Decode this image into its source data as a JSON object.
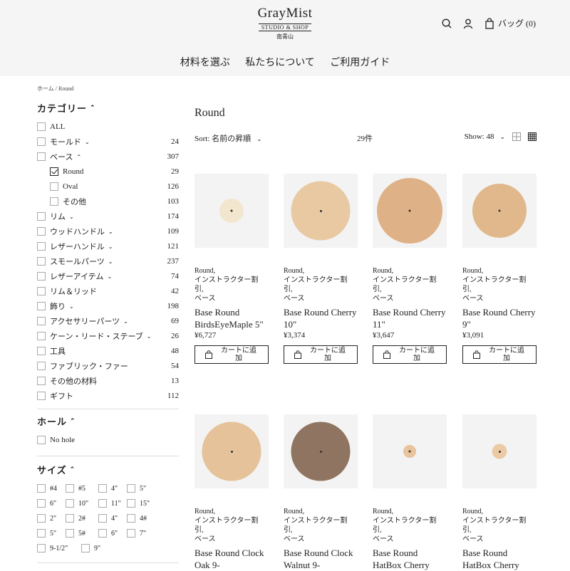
{
  "header": {
    "logo_main": "GrayMist",
    "logo_sub": "STUDIO & SHOP",
    "logo_sub2": "南青山",
    "bag_label": "バッグ (0)",
    "nav": [
      "材料を選ぶ",
      "私たちについて",
      "ご利用ガイド"
    ]
  },
  "breadcrumb": "ホーム / Round",
  "sidebar": {
    "category_title": "カテゴリー",
    "categories": [
      {
        "label": "ALL",
        "count": "",
        "chev": false,
        "checked": false,
        "indent": false
      },
      {
        "label": "モールド",
        "count": "24",
        "chev": "down",
        "checked": false,
        "indent": false
      },
      {
        "label": "ベース",
        "count": "307",
        "chev": "up",
        "checked": false,
        "indent": false
      },
      {
        "label": "Round",
        "count": "29",
        "chev": false,
        "checked": true,
        "indent": true
      },
      {
        "label": "Oval",
        "count": "126",
        "chev": false,
        "checked": false,
        "indent": true
      },
      {
        "label": "その他",
        "count": "103",
        "chev": false,
        "checked": false,
        "indent": true
      },
      {
        "label": "リム",
        "count": "174",
        "chev": "down",
        "checked": false,
        "indent": false
      },
      {
        "label": "ウッドハンドル",
        "count": "109",
        "chev": "down",
        "checked": false,
        "indent": false
      },
      {
        "label": "レザーハンドル",
        "count": "121",
        "chev": "down",
        "checked": false,
        "indent": false
      },
      {
        "label": "スモールパーツ",
        "count": "237",
        "chev": "down",
        "checked": false,
        "indent": false
      },
      {
        "label": "レザーアイテム",
        "count": "74",
        "chev": "down",
        "checked": false,
        "indent": false
      },
      {
        "label": "リム＆リッド",
        "count": "42",
        "chev": false,
        "checked": false,
        "indent": false
      },
      {
        "label": "飾り",
        "count": "198",
        "chev": "down",
        "checked": false,
        "indent": false
      },
      {
        "label": "アクセサリーパーツ",
        "count": "69",
        "chev": "down",
        "checked": false,
        "indent": false
      },
      {
        "label": "ケーン・リード・ステーブ",
        "count": "26",
        "chev": "down",
        "checked": false,
        "indent": false
      },
      {
        "label": "工具",
        "count": "48",
        "chev": false,
        "checked": false,
        "indent": false
      },
      {
        "label": "ファブリック・ファー",
        "count": "54",
        "chev": false,
        "checked": false,
        "indent": false
      },
      {
        "label": "その他の材料",
        "count": "13",
        "chev": false,
        "checked": false,
        "indent": false
      },
      {
        "label": "ギフト",
        "count": "112",
        "chev": false,
        "checked": false,
        "indent": false
      }
    ],
    "hole_title": "ホール",
    "hole_options": [
      "No hole"
    ],
    "size_title": "サイズ",
    "sizes": [
      [
        "#4",
        "#5",
        "4\"",
        "5\""
      ],
      [
        "6\"",
        "10\"",
        "11\"",
        "15\""
      ],
      [
        "2\"",
        "2#",
        "4\"",
        "4#"
      ],
      [
        "5\"",
        "5#",
        "6\"",
        "7\""
      ],
      [
        "9-1/2\"",
        "9\""
      ]
    ]
  },
  "main": {
    "title": "Round",
    "sort_label": "Sort: 名前の昇順",
    "count_label": "29件",
    "show_label": "Show: 48",
    "cart_label": "カートに追加",
    "products": [
      {
        "tags": [
          "Round,",
          "インストラクター割",
          "引,",
          "ベース"
        ],
        "name": "Base Round BirdsEyeMaple 5\"",
        "price": "¥6,727",
        "disc_size": 0.33,
        "disc_color": "#f2e6cf"
      },
      {
        "tags": [
          "Round,",
          "インストラクター割",
          "引,",
          "ベース"
        ],
        "name": "Base Round Cherry 10\"",
        "price": "¥3,374",
        "disc_size": 0.8,
        "disc_color": "#e8c9a2"
      },
      {
        "tags": [
          "Round,",
          "インストラクター割",
          "引,",
          "ベース"
        ],
        "name": "Base Round Cherry 11\"",
        "price": "¥3,647",
        "disc_size": 0.88,
        "disc_color": "#deb186"
      },
      {
        "tags": [
          "Round,",
          "インストラクター割",
          "引,",
          "ベース"
        ],
        "name": "Base Round Cherry 9\"",
        "price": "¥3,091",
        "disc_size": 0.73,
        "disc_color": "#e0b88c"
      },
      {
        "tags": [
          "Round,",
          "インストラクター割",
          "引,",
          "ベース"
        ],
        "name": "Base Round Clock Oak 9-",
        "price": "",
        "disc_size": 0.8,
        "disc_color": "#e6c29a"
      },
      {
        "tags": [
          "Round,",
          "インストラクター割",
          "引,",
          "ベース"
        ],
        "name": "Base Round Clock Walnut 9-",
        "price": "",
        "disc_size": 0.8,
        "disc_color": "#8f7561"
      },
      {
        "tags": [
          "Round,",
          "インストラクター割",
          "引,",
          "ベース"
        ],
        "name": "Base Round HatBox Cherry",
        "price": "",
        "disc_size": 0.17,
        "disc_color": "#e8c39c"
      },
      {
        "tags": [
          "Round,",
          "インストラクター割",
          "引,",
          "ベース"
        ],
        "name": "Base Round HatBox Cherry",
        "price": "",
        "disc_size": 0.2,
        "disc_color": "#eccaa4"
      }
    ]
  }
}
